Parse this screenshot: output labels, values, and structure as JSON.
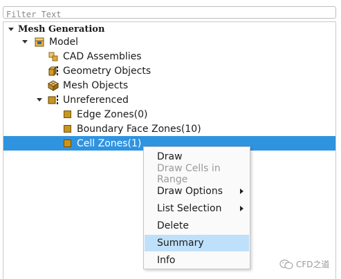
{
  "filter": {
    "placeholder": "Filter Text",
    "value": ""
  },
  "tree": {
    "root": {
      "label": "Mesh Generation",
      "expanded": true
    },
    "model": {
      "label": "Model",
      "icon": "model-box-icon",
      "expanded": true
    },
    "items": [
      {
        "label": "CAD Assemblies",
        "icon": "cad-assemblies-icon"
      },
      {
        "label": "Geometry Objects",
        "icon": "geometry-objects-icon"
      },
      {
        "label": "Mesh Objects",
        "icon": "mesh-objects-icon"
      }
    ],
    "unreferenced": {
      "label": "Unreferenced",
      "icon": "unreferenced-icon",
      "expanded": true,
      "children": [
        {
          "label": "Edge Zones(0)",
          "icon": "zone-icon"
        },
        {
          "label": "Boundary Face Zones(10)",
          "icon": "zone-icon"
        },
        {
          "label": "Cell Zones(1)",
          "icon": "zone-icon",
          "selected": true
        }
      ]
    }
  },
  "context_menu": {
    "items": [
      {
        "label": "Draw",
        "enabled": true
      },
      {
        "label": "Draw Cells in Range",
        "enabled": false
      },
      {
        "label": "Draw Options",
        "enabled": true,
        "submenu": true
      },
      {
        "label": "List Selection",
        "enabled": true,
        "submenu": true
      },
      {
        "label": "Delete",
        "enabled": true
      },
      {
        "label": "Summary",
        "enabled": true,
        "highlighted": true
      },
      {
        "label": "Info",
        "enabled": true
      }
    ]
  },
  "watermark": {
    "text": "CFD之道"
  },
  "colors": {
    "selection": "#3093e0",
    "menu_highlight": "#bfe0fb",
    "zone_icon": "#c8961e",
    "disabled_text": "#9a9a9a"
  }
}
